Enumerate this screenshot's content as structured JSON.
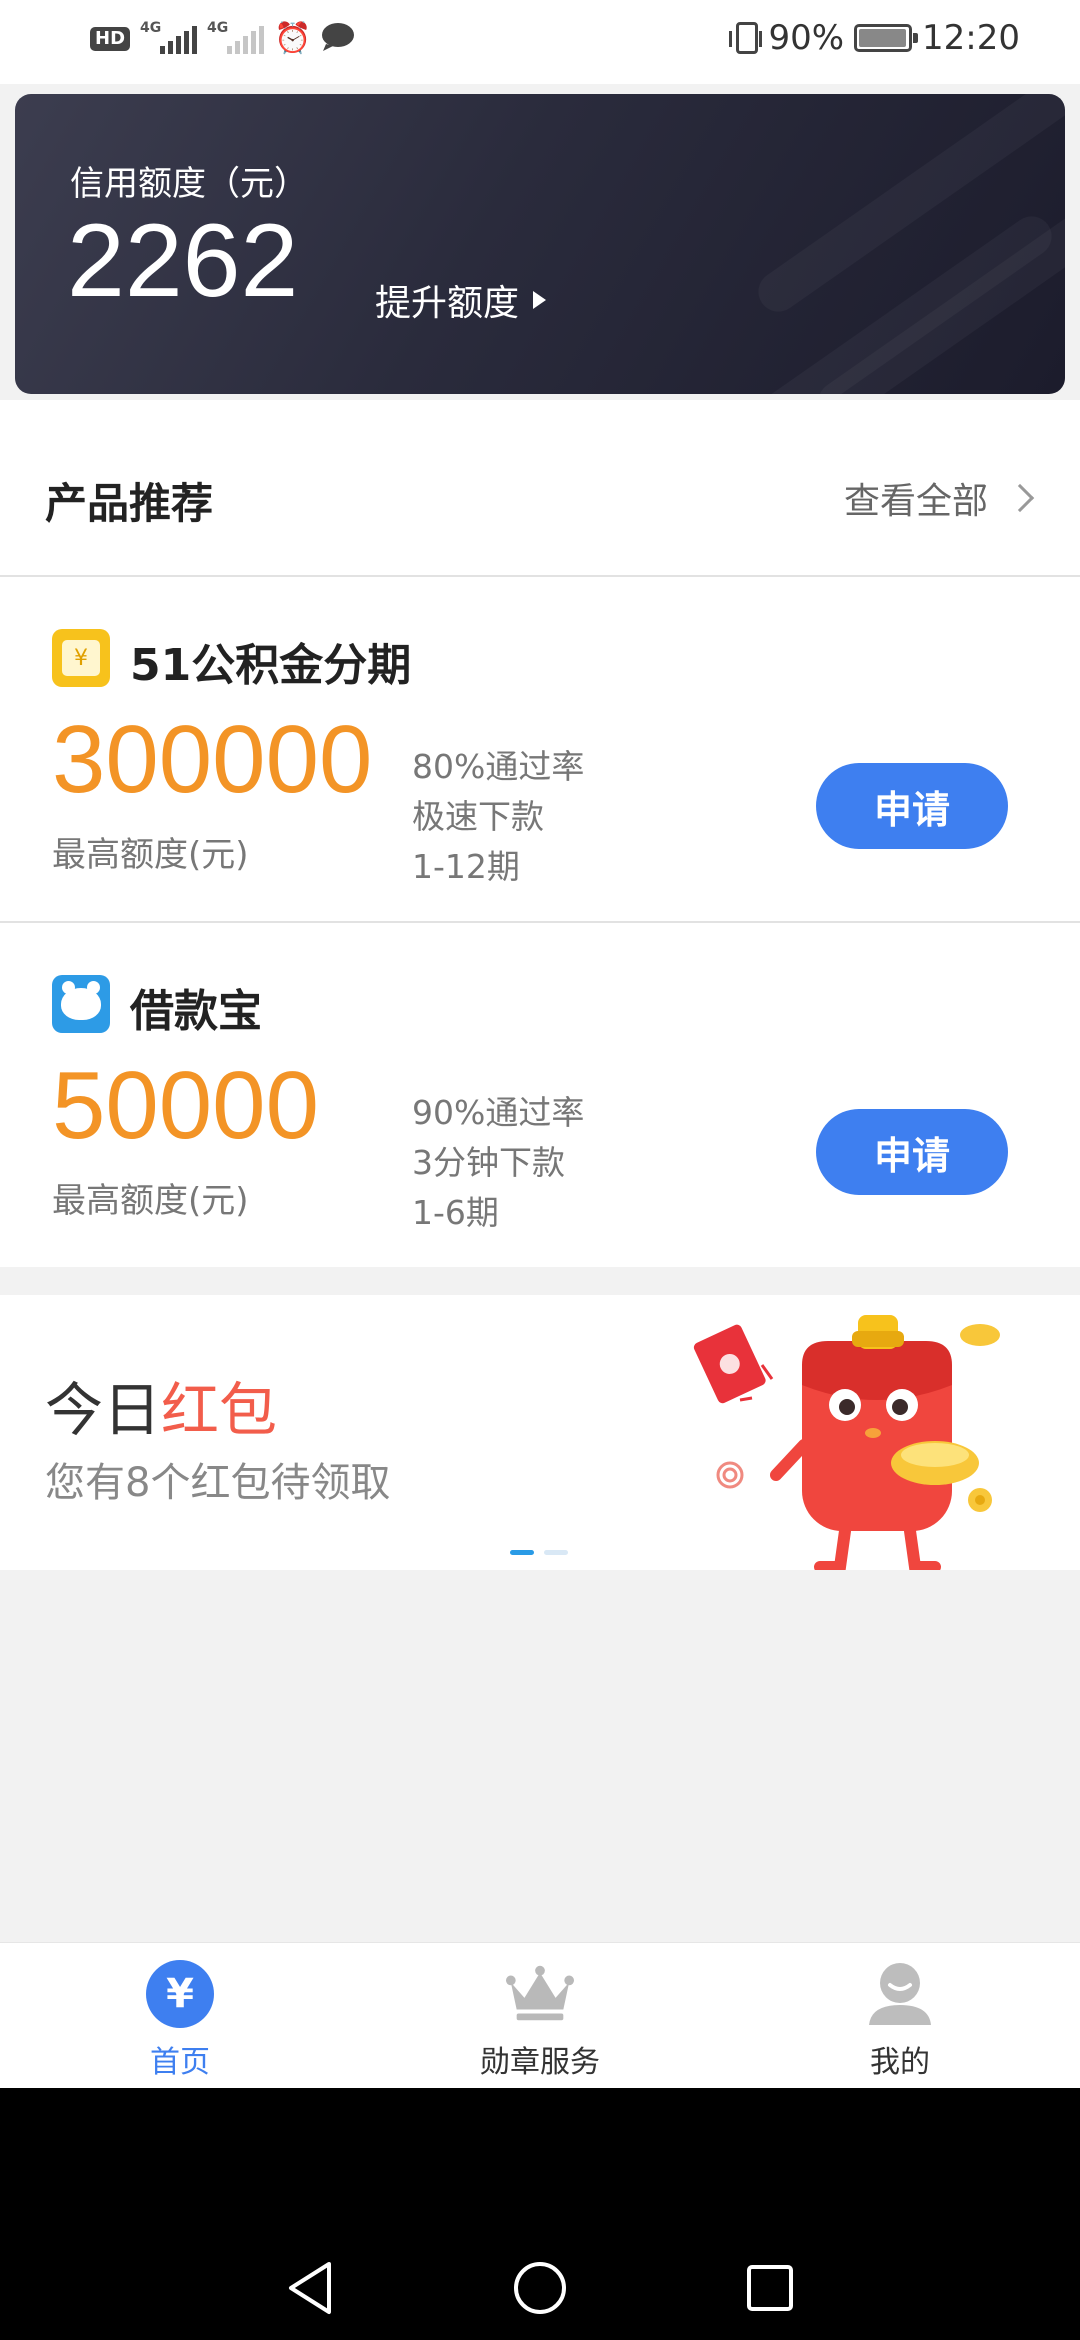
{
  "status_bar": {
    "hd_label": "HD",
    "sim1": "1",
    "net1": "4G",
    "net2": "4G",
    "battery_percent": "90%",
    "time": "12:20"
  },
  "credit": {
    "label": "信用额度（元）",
    "amount": "2262",
    "raise_label": "提升额度"
  },
  "section": {
    "title": "产品推荐",
    "view_all": "查看全部"
  },
  "products": [
    {
      "name": "51公积金分期",
      "icon": "yen-box-icon",
      "amount": "300000",
      "amount_label": "最高额度(元)",
      "features": [
        "80%通过率",
        "极速下款",
        "1-12期"
      ],
      "apply_label": "申请"
    },
    {
      "name": "借款宝",
      "icon": "bear-icon",
      "amount": "50000",
      "amount_label": "最高额度(元)",
      "features": [
        "90%通过率",
        "3分钟下款",
        "1-6期"
      ],
      "apply_label": "申请"
    }
  ],
  "banner": {
    "title_prefix": "今日",
    "title_highlight": "红包",
    "subtitle": "您有8个红包待领取",
    "page_count": 2,
    "active_page": 1
  },
  "tabs": [
    {
      "label": "首页",
      "icon": "yen-icon",
      "active": true
    },
    {
      "label": "勋章服务",
      "icon": "crown-icon",
      "active": false
    },
    {
      "label": "我的",
      "icon": "user-icon",
      "active": false
    }
  ],
  "colors": {
    "accent_blue": "#3e7ff0",
    "amount_orange": "#f39426",
    "highlight_red": "#f25d4b",
    "card_dark": "#2a2b3c"
  }
}
